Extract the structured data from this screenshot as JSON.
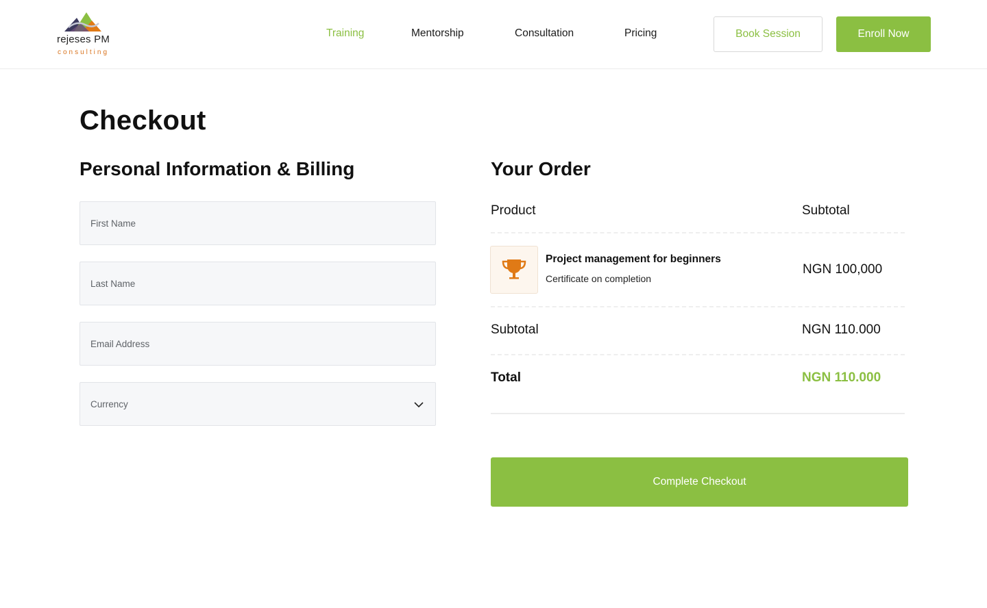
{
  "brand": {
    "name": "rejeses PM",
    "tagline": "consulting"
  },
  "nav": {
    "items": [
      {
        "label": "Training",
        "active": true
      },
      {
        "label": "Mentorship",
        "active": false
      },
      {
        "label": "Consultation",
        "active": false
      },
      {
        "label": "Pricing",
        "active": false
      }
    ],
    "book_label": "Book Session",
    "enroll_label": "Enroll Now"
  },
  "page": {
    "title": "Checkout"
  },
  "billing": {
    "title": "Personal Information & Billing",
    "first_name": {
      "placeholder": "First Name",
      "value": ""
    },
    "last_name": {
      "placeholder": "Last Name",
      "value": ""
    },
    "email": {
      "placeholder": "Email Address",
      "value": ""
    },
    "currency": {
      "placeholder": "Currency",
      "value": ""
    }
  },
  "order": {
    "title": "Your Order",
    "product_header": "Product",
    "subtotal_header": "Subtotal",
    "item": {
      "name": "Project management for beginners",
      "description": "Certificate on completion",
      "price": "NGN 100,000",
      "icon": "trophy-icon"
    },
    "subtotal_label": "Subtotal",
    "subtotal_value": "NGN 110.000",
    "total_label": "Total",
    "total_value": "NGN 110.000",
    "checkout_label": "Complete Checkout"
  },
  "colors": {
    "accent": "#8bbf42",
    "brand_orange": "#d9741f",
    "trophy": "#e07a16"
  }
}
